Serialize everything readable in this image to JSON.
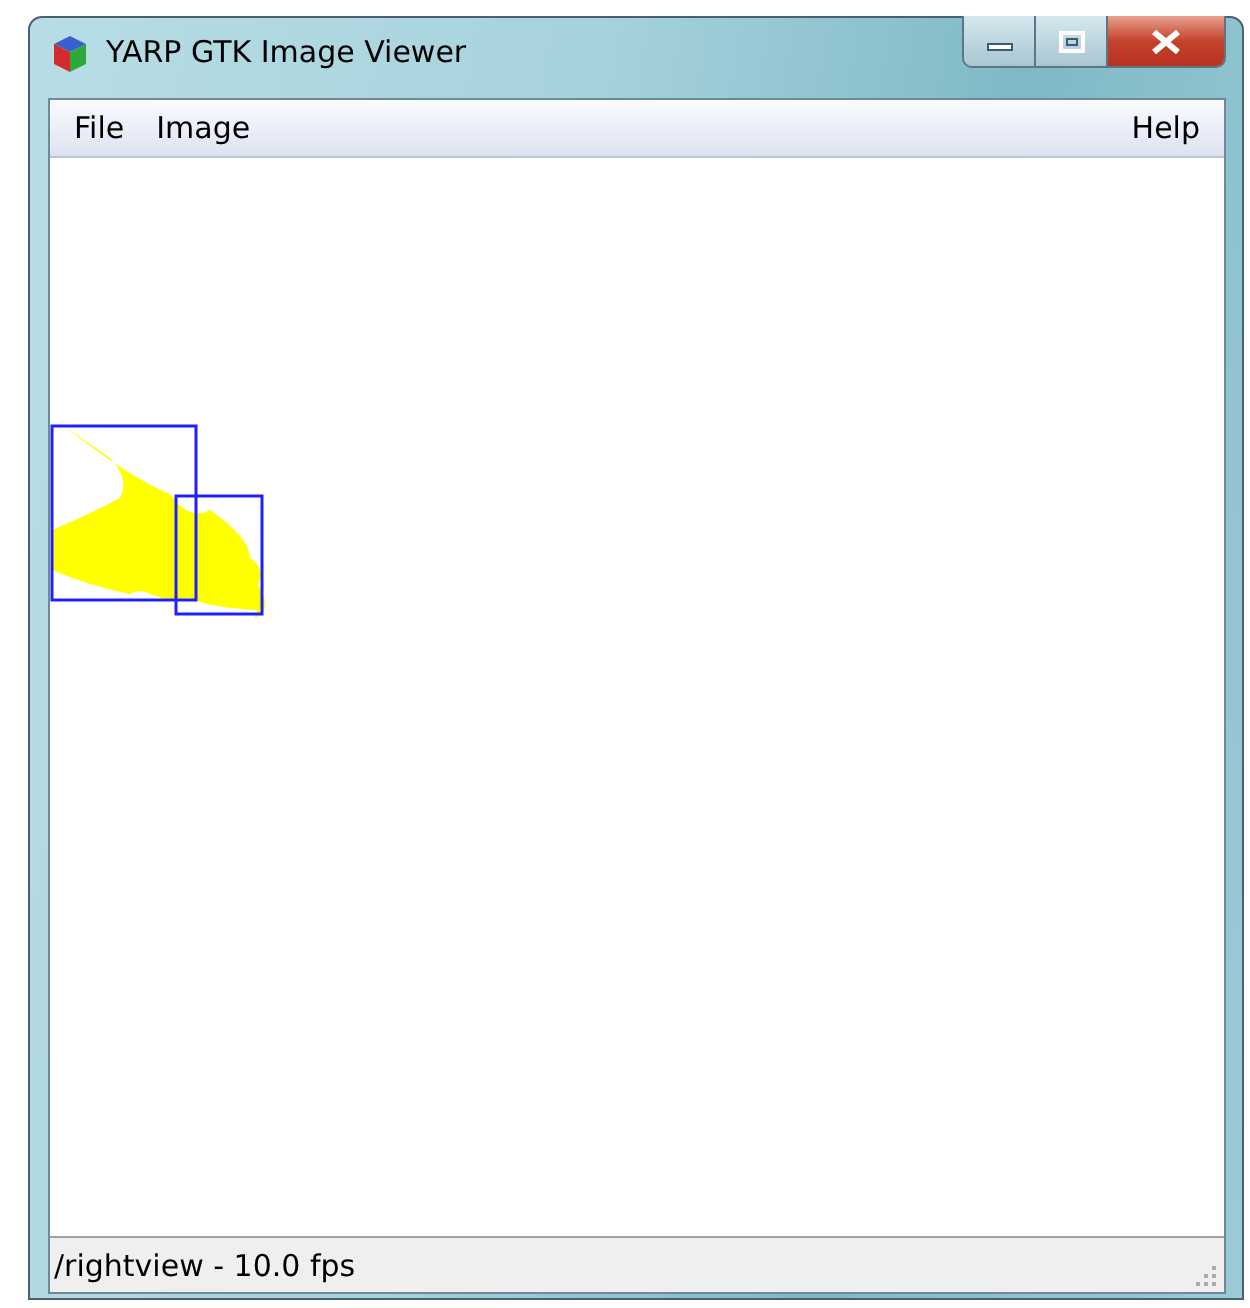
{
  "window": {
    "title": "YARP GTK Image Viewer"
  },
  "menu": {
    "left": [
      {
        "label": "File"
      },
      {
        "label": "Image"
      }
    ],
    "right": [
      {
        "label": "Help"
      }
    ]
  },
  "status_bar": {
    "text": "/rightview - 10.0 fps"
  }
}
